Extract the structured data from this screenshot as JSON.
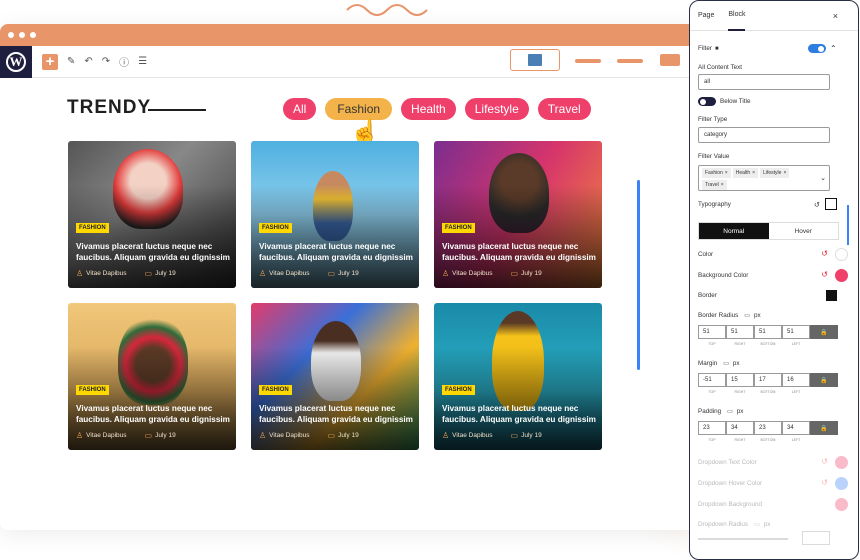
{
  "editor": {
    "toolbar": {
      "logo": "W",
      "add": "+",
      "icons": [
        "pen-icon",
        "undo-icon",
        "redo-icon",
        "info-icon",
        "list-icon"
      ]
    },
    "heading": "TRENDY",
    "filters": [
      {
        "label": "All",
        "active": false
      },
      {
        "label": "Fashion",
        "active": true
      },
      {
        "label": "Health",
        "active": false
      },
      {
        "label": "Lifestyle",
        "active": false
      },
      {
        "label": "Travel",
        "active": false
      }
    ],
    "cards": [
      {
        "tag": "FASHION",
        "title": "Vivamus placerat luctus neque nec faucibus. Aliquam gravida eu dignissim",
        "author": "Vitae Dapibus",
        "date": "July 19"
      },
      {
        "tag": "FASHION",
        "title": "Vivamus placerat luctus neque nec faucibus. Aliquam gravida eu dignissim",
        "author": "Vitae Dapibus",
        "date": "July 19"
      },
      {
        "tag": "FASHION",
        "title": "Vivamus placerat luctus neque nec faucibus. Aliquam gravida eu dignissim",
        "author": "Vitae Dapibus",
        "date": "July 19"
      },
      {
        "tag": "FASHION",
        "title": "Vivamus placerat luctus neque nec faucibus. Aliquam gravida eu dignissim",
        "author": "Vitae Dapibus",
        "date": "July 19"
      },
      {
        "tag": "FASHION",
        "title": "Vivamus placerat luctus neque nec faucibus. Aliquam gravida eu dignissim",
        "author": "Vitae Dapibus",
        "date": "July 19"
      },
      {
        "tag": "FASHION",
        "title": "Vivamus placerat luctus neque nec faucibus. Aliquam gravida eu dignissim",
        "author": "Vitae Dapibus",
        "date": "July 19"
      }
    ]
  },
  "panel": {
    "tabs": [
      "Page",
      "Block"
    ],
    "close": "×",
    "filter_label": "Filter",
    "all_content_text_label": "All Content Text",
    "all_content_text_value": "all",
    "below_title_label": "Below Title",
    "filter_type_label": "Filter Type",
    "filter_type_value": "category",
    "filter_value_label": "Filter Value",
    "filter_values": [
      "Fashion",
      "Health",
      "Lifestyle",
      "Travel"
    ],
    "typography_label": "Typography",
    "state_tabs": [
      "Normal",
      "Hover"
    ],
    "color_label": "Color",
    "bg_color_label": "Background Color",
    "border_label": "Border",
    "border_radius_label": "Border Radius",
    "border_radius_unit": "px",
    "border_radius_values": [
      "51",
      "51",
      "51",
      "51"
    ],
    "margin_label": "Margin",
    "margin_unit": "px",
    "margin_values": [
      "-51",
      "15",
      "17",
      "16"
    ],
    "padding_label": "Padding",
    "padding_unit": "px",
    "padding_values": [
      "23",
      "34",
      "23",
      "34"
    ],
    "sublabels": [
      "TOP",
      "RIGHT",
      "BOTTOM",
      "LEFT"
    ],
    "dropdown_text_color_label": "Dropdown Text Color",
    "dropdown_hover_color_label": "Dropdown Hover Color",
    "dropdown_background_label": "Dropdown Background",
    "dropdown_radius_label": "Dropdown Radius",
    "dropdown_radius_unit": "px"
  },
  "colors": {
    "accent": "#e8956a",
    "chip": "#ef3f6b",
    "chip_active": "#f3b34a",
    "tag": "#ffd800",
    "toggle_on": "#2e7de1"
  }
}
